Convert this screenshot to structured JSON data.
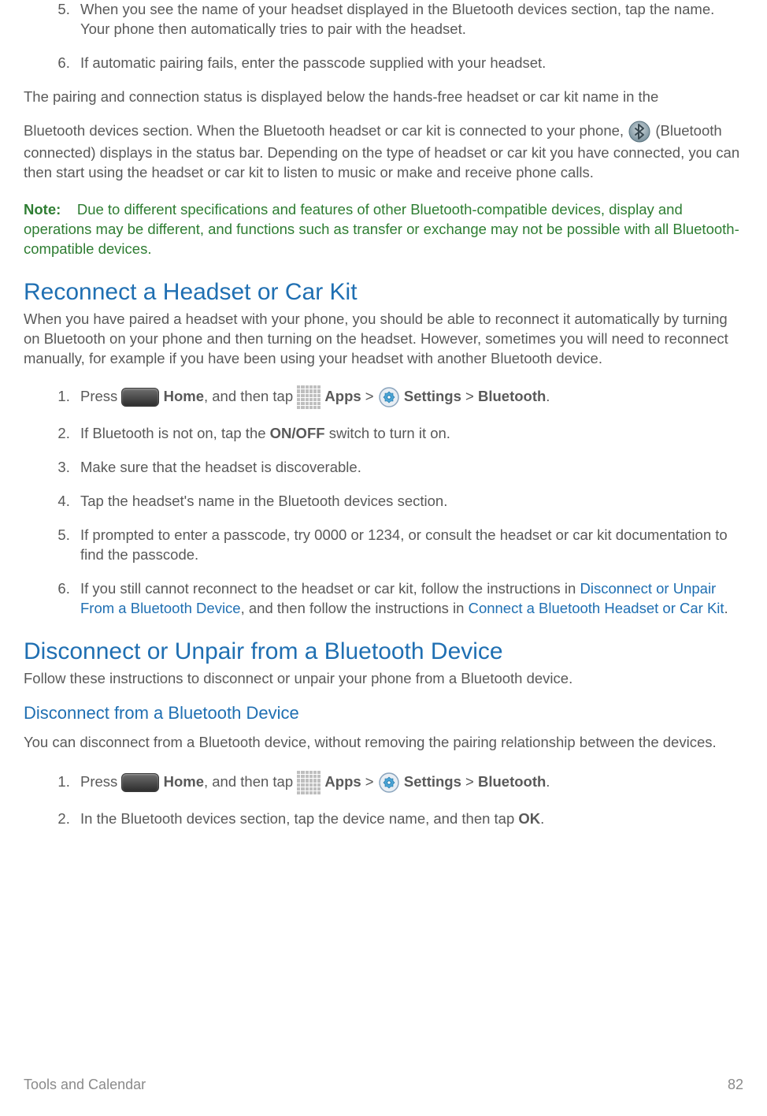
{
  "steps_a": {
    "start": 5,
    "items": [
      "When you see the name of your headset displayed in the Bluetooth devices section, tap the name. Your phone then automatically tries to pair with the headset.",
      "If automatic pairing fails, enter the passcode supplied with your headset."
    ]
  },
  "para1": "The pairing and connection status is displayed below the hands-free headset or car kit name in the",
  "para2_a": "Bluetooth devices section. When the Bluetooth headset or car kit is connected to your phone, ",
  "para2_b": " (Bluetooth connected) displays in the status bar. Depending on the type of headset or car kit you have connected, you can then start using the headset or car kit to listen to music or make and receive phone calls.",
  "note_label": "Note:",
  "note_body": "Due to different specifications and features of other Bluetooth-compatible devices, display and operations may be different, and functions such as transfer or exchange may not be possible with all Bluetooth-compatible devices.",
  "section_reconnect": "Reconnect a Headset or Car Kit",
  "reconnect_intro": "When you have paired a headset with your phone, you should be able to reconnect it automatically by turning on Bluetooth on your phone and then turning on the headset. However, sometimes you will need to reconnect manually, for example if you have been using your headset with another Bluetooth device.",
  "recon": {
    "s1_a": "Press ",
    "s1_home": " Home",
    "s1_b": ", and then tap ",
    "s1_apps": " Apps",
    "s1_gt1": " > ",
    "s1_settings": " Settings",
    "s1_gt2": " > ",
    "s1_bt": "Bluetooth",
    "s1_dot": ".",
    "s2_a": "If Bluetooth is not on, tap the ",
    "s2_onoff": "ON/OFF",
    "s2_b": " switch to turn it on.",
    "s3": "Make sure that the headset is discoverable.",
    "s4": "Tap the headset's name in the Bluetooth devices section.",
    "s5": "If prompted to enter a passcode, try 0000 or 1234, or consult the headset or car kit documentation to find the passcode.",
    "s6_a": "If you still cannot reconnect to the headset or car kit, follow the instructions in ",
    "s6_link1": "Disconnect or Unpair From a Bluetooth Device",
    "s6_b": ", and then follow the instructions in ",
    "s6_link2": "Connect a Bluetooth Headset or Car Kit",
    "s6_dot": "."
  },
  "section_disc": "Disconnect or Unpair from a Bluetooth Device",
  "disc_intro": "Follow these instructions to disconnect or unpair your phone from a Bluetooth device.",
  "subsection_disc": "Disconnect from a Bluetooth Device",
  "disc_para": "You can disconnect from a Bluetooth device, without removing the pairing relationship between the devices.",
  "disc": {
    "s1_a": "Press ",
    "s1_home": " Home",
    "s1_b": ", and then tap ",
    "s1_apps": " Apps",
    "s1_gt1": " > ",
    "s1_settings": " Settings",
    "s1_gt2": " > ",
    "s1_bt": "Bluetooth",
    "s1_dot": ".",
    "s2_a": "In the Bluetooth devices section, tap the device name, and then tap ",
    "s2_ok": "OK",
    "s2_dot": "."
  },
  "footer_left": "Tools and Calendar",
  "footer_right": "82"
}
